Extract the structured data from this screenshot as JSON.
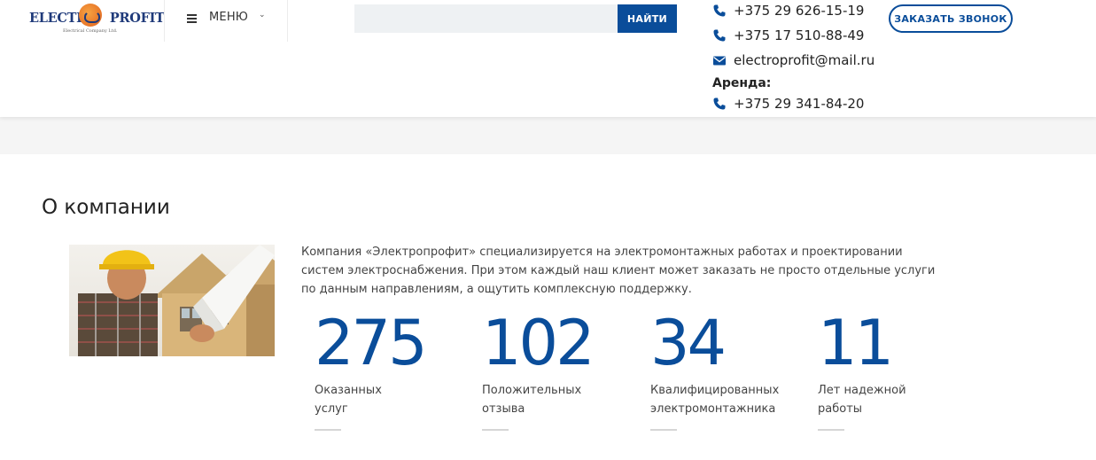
{
  "header": {
    "logo": {
      "text_left": "ELECTR",
      "text_right": "PROFIT",
      "subtitle": "Electrical Company Ltd."
    },
    "menu_label": "МЕНЮ",
    "search": {
      "placeholder": "",
      "button_label": "НАЙТИ"
    },
    "contacts": {
      "phone1": "+375 29 626-15-19",
      "phone2": "+375 17 510-88-49",
      "email": "electroprofit@mail.ru",
      "arenda_label": "Аренда:",
      "phone3": "+375 29 341-84-20"
    },
    "callback_label": "ЗАКАЗАТЬ ЗВОНОК"
  },
  "about": {
    "title": "О компании",
    "text": "Компания «Электропрофит» специализируется на электромонтажных работах и проектировании систем электроснабжения. При этом каждый наш клиент может заказать не просто отдельные услуги по данным направлениям, а ощутить комплексную поддержку.",
    "stats": [
      {
        "value": "275",
        "label_line1": "Оказанных",
        "label_line2": "услуг"
      },
      {
        "value": "102",
        "label_line1": "Положительных",
        "label_line2": "отзыва"
      },
      {
        "value": "34",
        "label_line1": "Квалифицированных",
        "label_line2": "электромонтажника"
      },
      {
        "value": "11",
        "label_line1": "Лет надежной",
        "label_line2": "работы"
      }
    ]
  },
  "colors": {
    "accent": "#0a4d9a",
    "band": "#f5f5f5"
  },
  "icons": {
    "phone": "phone-icon",
    "email": "envelope-icon",
    "menu": "hamburger-icon",
    "chevron": "chevron-down-icon"
  }
}
